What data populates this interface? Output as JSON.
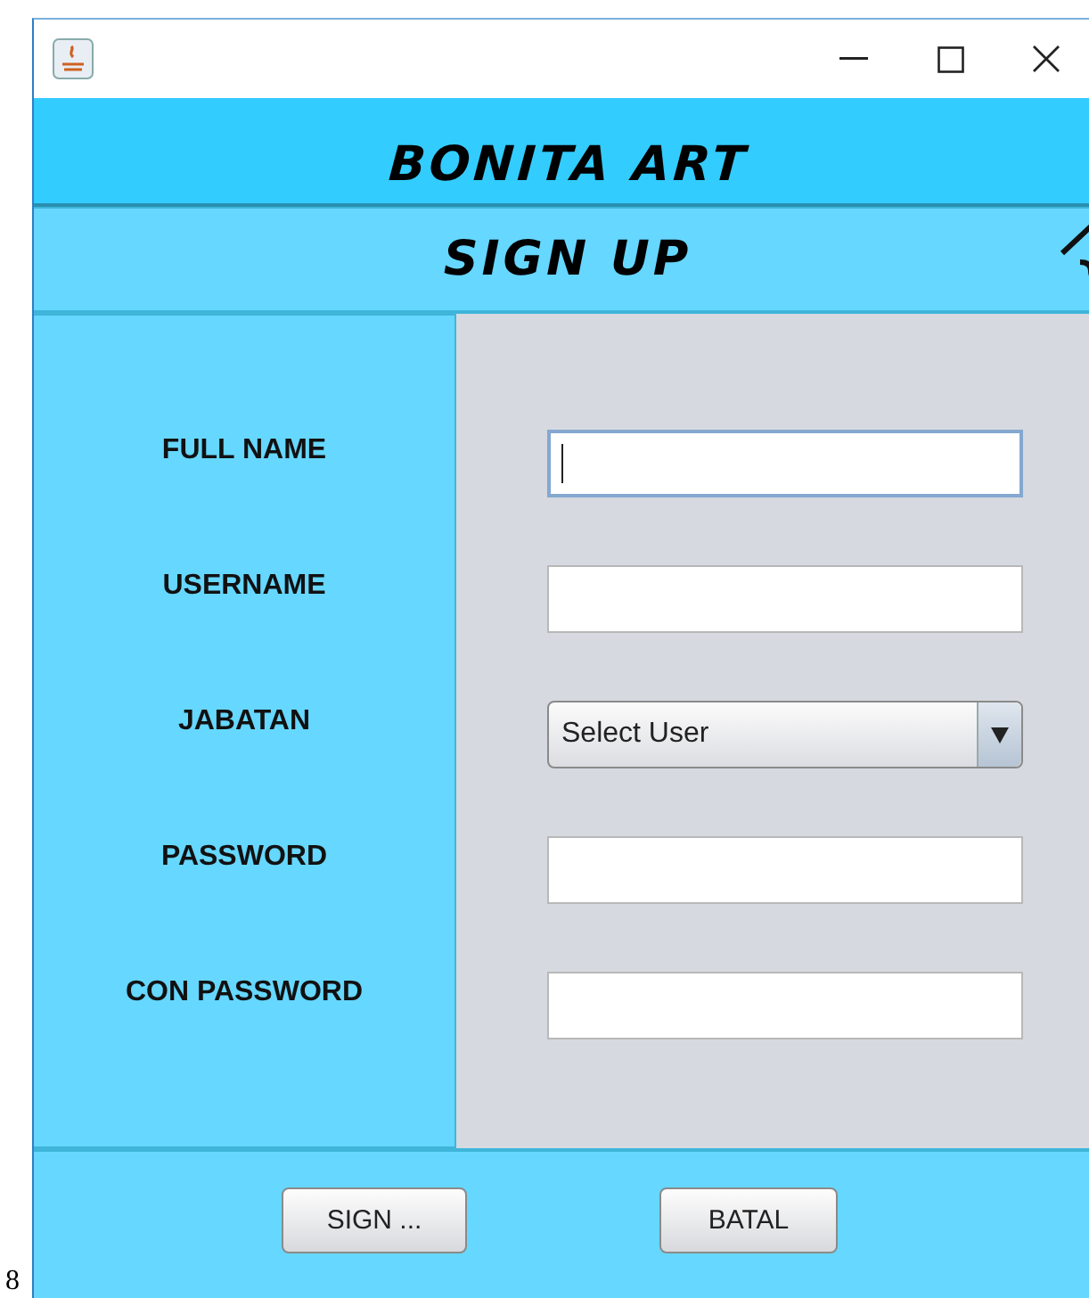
{
  "window": {
    "header": "BONITA ART",
    "subheader": "SIGN UP"
  },
  "form": {
    "fields": [
      {
        "label": "FULL NAME",
        "kind": "text",
        "focused": true
      },
      {
        "label": "USERNAME",
        "kind": "text",
        "focused": false
      },
      {
        "label": "JABATAN",
        "kind": "select",
        "value": "Select User"
      },
      {
        "label": "PASSWORD",
        "kind": "text",
        "focused": false
      },
      {
        "label": "CON PASSWORD",
        "kind": "text",
        "focused": false
      }
    ]
  },
  "buttons": [
    "SIGN ...",
    "BATAL"
  ],
  "page_number": "8"
}
